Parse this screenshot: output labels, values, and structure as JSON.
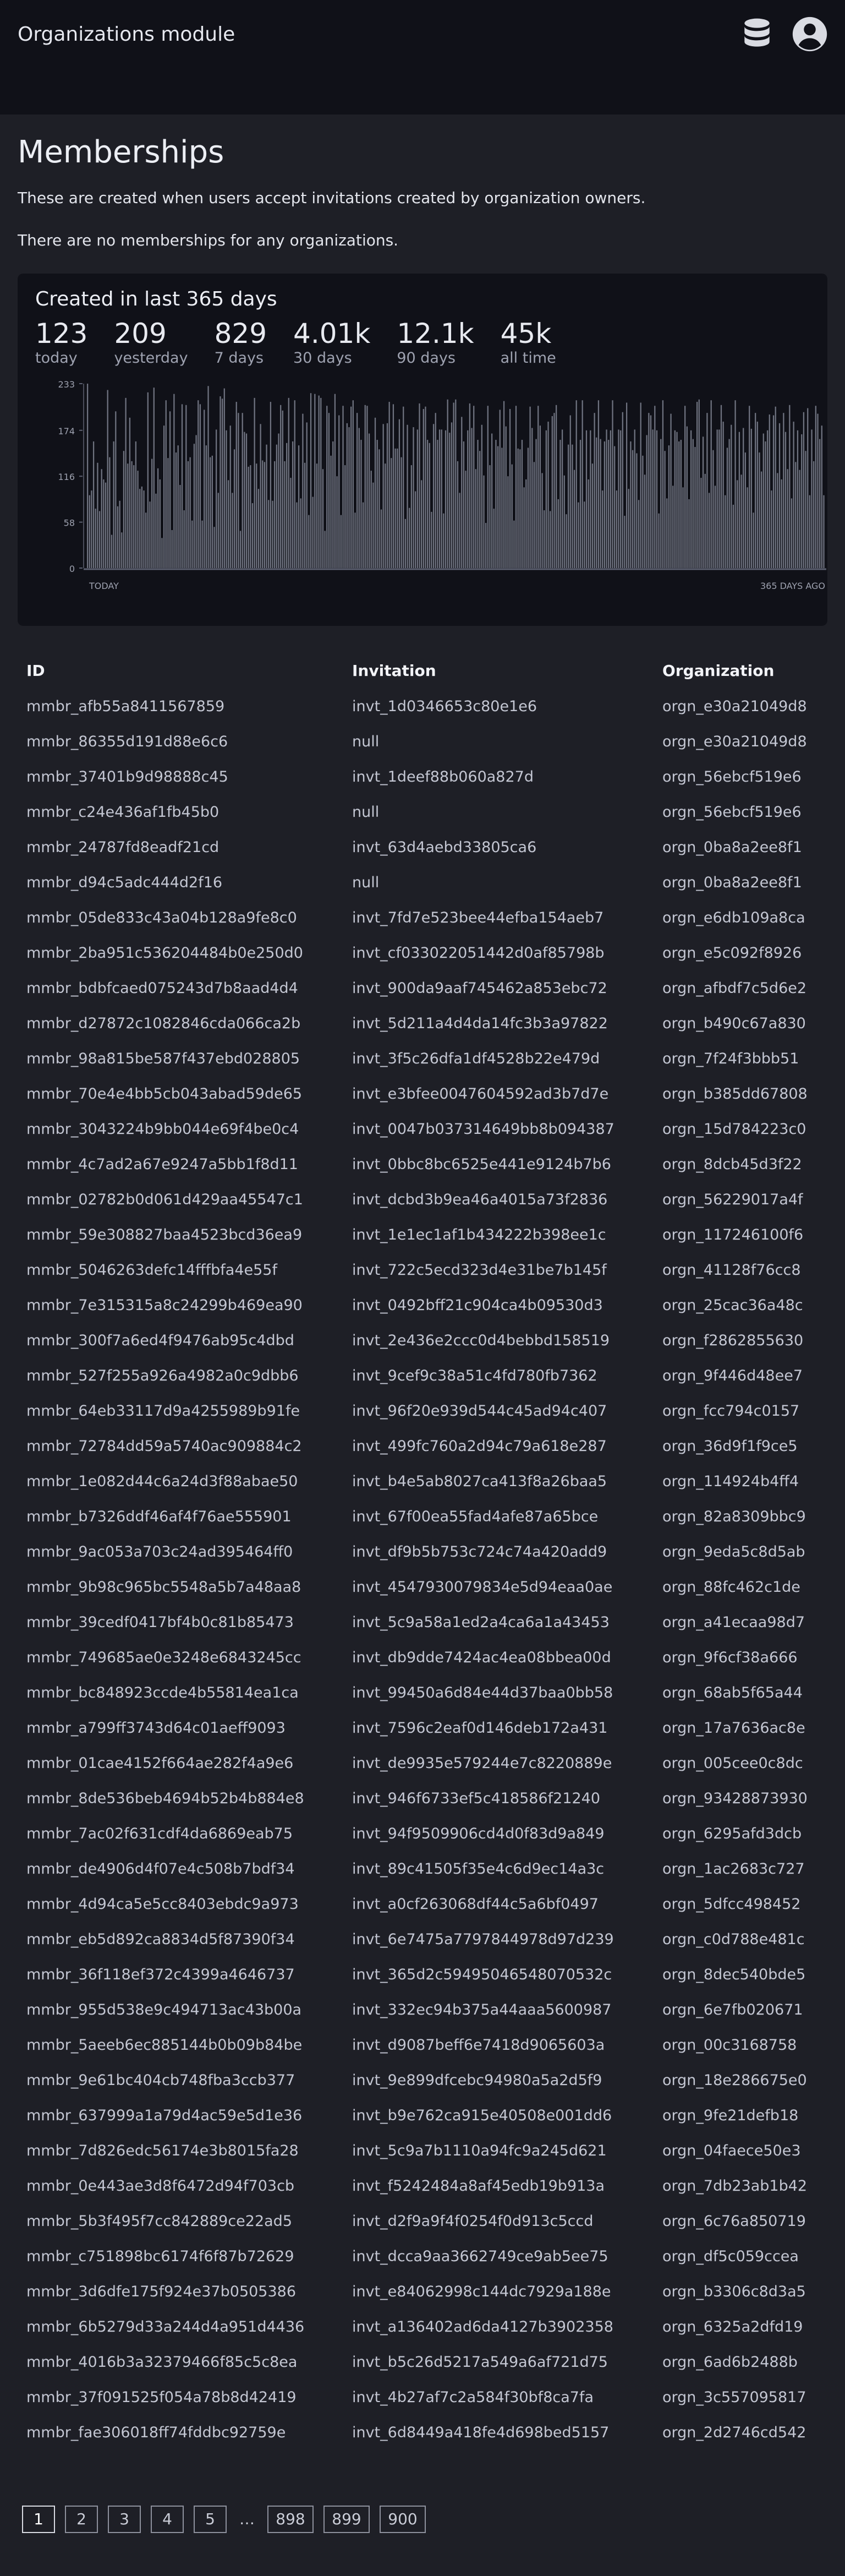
{
  "header": {
    "title": "Organizations module",
    "icons": [
      "database-icon",
      "user-account-icon"
    ]
  },
  "main": {
    "title": "Memberships",
    "description": "These are created when users accept invitations created by organization owners.",
    "empty_note": "There are no memberships for any organizations."
  },
  "stats_card": {
    "title": "Created in last 365 days",
    "stats": [
      {
        "value": "123",
        "label": "today"
      },
      {
        "value": "209",
        "label": "yesterday"
      },
      {
        "value": "829",
        "label": "7 days"
      },
      {
        "value": "4.01k",
        "label": "30 days"
      },
      {
        "value": "12.1k",
        "label": "90 days"
      },
      {
        "value": "45k",
        "label": "all time"
      }
    ]
  },
  "chart_data": {
    "type": "bar",
    "title": "",
    "xlabel": "",
    "ylabel": "",
    "x_start_label": "TODAY",
    "x_end_label": "365 DAYS AGO",
    "y_ticks": [
      0,
      58,
      116,
      174,
      233
    ],
    "ylim": [
      0,
      233
    ],
    "grid": false,
    "bar_color": "#6f7380",
    "values": [
      233,
      92,
      98,
      160,
      75,
      133,
      72,
      125,
      112,
      108,
      225,
      140,
      42,
      160,
      198,
      78,
      85,
      45,
      148,
      215,
      132,
      190,
      135,
      130,
      160,
      123,
      100,
      103,
      98,
      70,
      222,
      84,
      138,
      228,
      94,
      126,
      112,
      38,
      180,
      212,
      139,
      198,
      48,
      220,
      146,
      155,
      105,
      207,
      73,
      206,
      135,
      140,
      60,
      157,
      168,
      212,
      207,
      60,
      200,
      155,
      230,
      140,
      142,
      52,
      175,
      95,
      217,
      214,
      227,
      174,
      111,
      180,
      95,
      150,
      210,
      196,
      47,
      196,
      172,
      170,
      128,
      130,
      82,
      215,
      132,
      100,
      182,
      136,
      134,
      156,
      86,
      210,
      85,
      135,
      156,
      170,
      206,
      199,
      135,
      158,
      215,
      114,
      160,
      212,
      83,
      155,
      88,
      195,
      133,
      184,
      67,
      221,
      90,
      220,
      132,
      218,
      215,
      125,
      47,
      205,
      196,
      142,
      160,
      220,
      116,
      193,
      67,
      205,
      130,
      183,
      178,
      204,
      212,
      70,
      196,
      177,
      162,
      83,
      206,
      205,
      170,
      123,
      108,
      190,
      162,
      150,
      74,
      182,
      132,
      183,
      210,
      139,
      207,
      151,
      151,
      188,
      140,
      204,
      62,
      181,
      76,
      130,
      178,
      97,
      175,
      208,
      111,
      201,
      204,
      162,
      158,
      71,
      182,
      196,
      162,
      175,
      175,
      69,
      174,
      213,
      171,
      184,
      209,
      213,
      135,
      95,
      191,
      160,
      123,
      174,
      208,
      177,
      205,
      125,
      162,
      148,
      181,
      117,
      57,
      205,
      130,
      170,
      75,
      162,
      154,
      200,
      152,
      211,
      179,
      116,
      201,
      131,
      60,
      205,
      151,
      150,
      162,
      102,
      112,
      152,
      204,
      177,
      134,
      163,
      205,
      180,
      120,
      73,
      174,
      185,
      72,
      192,
      196,
      206,
      87,
      162,
      175,
      117,
      68,
      156,
      193,
      156,
      124,
      212,
      83,
      162,
      212,
      84,
      174,
      112,
      174,
      132,
      196,
      165,
      212,
      163,
      98,
      160,
      175,
      162,
      174,
      212,
      154,
      98,
      175,
      174,
      197,
      66,
      209,
      100,
      160,
      149,
      175,
      145,
      86,
      209,
      142,
      118,
      168,
      196,
      193,
      175,
      205,
      174,
      69,
      163,
      212,
      148,
      88,
      155,
      195,
      104,
      174,
      172,
      160,
      162,
      102,
      205,
      179,
      87,
      174,
      163,
      153,
      210,
      213,
      114,
      166,
      119,
      196,
      95,
      212,
      149,
      104,
      175,
      175,
      206,
      185,
      92,
      152,
      163,
      181,
      80,
      212,
      111,
      172,
      118,
      177,
      146,
      102,
      205,
      176,
      70,
      196,
      185,
      146,
      122,
      170,
      160,
      174,
      194,
      98,
      193,
      204,
      120,
      183,
      112,
      196,
      172,
      125,
      206,
      88,
      185,
      134,
      174,
      124,
      169,
      197,
      148,
      202,
      92,
      175,
      135,
      205,
      195,
      163,
      180,
      92
    ]
  },
  "table": {
    "headers": [
      "ID",
      "Invitation",
      "Organization"
    ],
    "rows": [
      [
        "mmbr_afb55a8411567859",
        "invt_1d0346653c80e1e6",
        "orgn_e30a21049d8"
      ],
      [
        "mmbr_86355d191d88e6c6",
        "null",
        "orgn_e30a21049d8"
      ],
      [
        "mmbr_37401b9d98888c45",
        "invt_1deef88b060a827d",
        "orgn_56ebcf519e6"
      ],
      [
        "mmbr_c24e436af1fb45b0",
        "null",
        "orgn_56ebcf519e6"
      ],
      [
        "mmbr_24787fd8eadf21cd",
        "invt_63d4aebd33805ca6",
        "orgn_0ba8a2ee8f1"
      ],
      [
        "mmbr_d94c5adc444d2f16",
        "null",
        "orgn_0ba8a2ee8f1"
      ],
      [
        "mmbr_05de833c43a04b128a9fe8c0",
        "invt_7fd7e523bee44efba154aeb7",
        "orgn_e6db109a8ca"
      ],
      [
        "mmbr_2ba951c536204484b0e250d0",
        "invt_cf033022051442d0af85798b",
        "orgn_e5c092f8926"
      ],
      [
        "mmbr_bdbfcaed075243d7b8aad4d4",
        "invt_900da9aaf745462a853ebc72",
        "orgn_afbdf7c5d6e2"
      ],
      [
        "mmbr_d27872c1082846cda066ca2b",
        "invt_5d211a4d4da14fc3b3a97822",
        "orgn_b490c67a830"
      ],
      [
        "mmbr_98a815be587f437ebd028805",
        "invt_3f5c26dfa1df4528b22e479d",
        "orgn_7f24f3bbb51"
      ],
      [
        "mmbr_70e4e4bb5cb043abad59de65",
        "invt_e3bfee0047604592ad3b7d7e",
        "orgn_b385dd67808"
      ],
      [
        "mmbr_3043224b9bb044e69f4be0c4",
        "invt_0047b037314649bb8b094387",
        "orgn_15d784223c0"
      ],
      [
        "mmbr_4c7ad2a67e9247a5bb1f8d11",
        "invt_0bbc8bc6525e441e9124b7b6",
        "orgn_8dcb45d3f22"
      ],
      [
        "mmbr_02782b0d061d429aa45547c1",
        "invt_dcbd3b9ea46a4015a73f2836",
        "orgn_56229017a4f"
      ],
      [
        "mmbr_59e308827baa4523bcd36ea9",
        "invt_1e1ec1af1b434222b398ee1c",
        "orgn_117246100f6"
      ],
      [
        "mmbr_5046263defc14fffbfa4e55f",
        "invt_722c5ecd323d4e31be7b145f",
        "orgn_41128f76cc8"
      ],
      [
        "mmbr_7e315315a8c24299b469ea90",
        "invt_0492bff21c904ca4b09530d3",
        "orgn_25cac36a48c"
      ],
      [
        "mmbr_300f7a6ed4f9476ab95c4dbd",
        "invt_2e436e2ccc0d4bebbd158519",
        "orgn_f2862855630"
      ],
      [
        "mmbr_527f255a926a4982a0c9dbb6",
        "invt_9cef9c38a51c4fd780fb7362",
        "orgn_9f446d48ee7"
      ],
      [
        "mmbr_64eb33117d9a4255989b91fe",
        "invt_96f20e939d544c45ad94c407",
        "orgn_fcc794c0157"
      ],
      [
        "mmbr_72784dd59a5740ac909884c2",
        "invt_499fc760a2d94c79a618e287",
        "orgn_36d9f1f9ce5"
      ],
      [
        "mmbr_1e082d44c6a24d3f88abae50",
        "invt_b4e5ab8027ca413f8a26baa5",
        "orgn_114924b4ff4"
      ],
      [
        "mmbr_b7326ddf46af4f76ae555901",
        "invt_67f00ea55fad4afe87a65bce",
        "orgn_82a8309bbc9"
      ],
      [
        "mmbr_9ac053a703c24ad395464ff0",
        "invt_df9b5b753c724c74a420add9",
        "orgn_9eda5c8d5ab"
      ],
      [
        "mmbr_9b98c965bc5548a5b7a48aa8",
        "invt_4547930079834e5d94eaa0ae",
        "orgn_88fc462c1de"
      ],
      [
        "mmbr_39cedf0417bf4b0c81b85473",
        "invt_5c9a58a1ed2a4ca6a1a43453",
        "orgn_a41ecaa98d7"
      ],
      [
        "mmbr_749685ae0e3248e6843245cc",
        "invt_db9dde7424ac4ea08bbea00d",
        "orgn_9f6cf38a666"
      ],
      [
        "mmbr_bc848923ccde4b55814ea1ca",
        "invt_99450a6d84e44d37baa0bb58",
        "orgn_68ab5f65a44"
      ],
      [
        "mmbr_a799ff3743d64c01aeff9093",
        "invt_7596c2eaf0d146deb172a431",
        "orgn_17a7636ac8e"
      ],
      [
        "mmbr_01cae4152f664ae282f4a9e6",
        "invt_de9935e579244e7c8220889e",
        "orgn_005cee0c8dc"
      ],
      [
        "mmbr_8de536beb4694b52b4b884e8",
        "invt_946f6733ef5c418586f21240",
        "orgn_93428873930"
      ],
      [
        "mmbr_7ac02f631cdf4da6869eab75",
        "invt_94f9509906cd4d0f83d9a849",
        "orgn_6295afd3dcb"
      ],
      [
        "mmbr_de4906d4f07e4c508b7bdf34",
        "invt_89c41505f35e4c6d9ec14a3c",
        "orgn_1ac2683c727"
      ],
      [
        "mmbr_4d94ca5e5cc8403ebdc9a973",
        "invt_a0cf263068df44c5a6bf0497",
        "orgn_5dfcc498452"
      ],
      [
        "mmbr_eb5d892ca8834d5f87390f34",
        "invt_6e7475a7797844978d97d239",
        "orgn_c0d788e481c"
      ],
      [
        "mmbr_36f118ef372c4399a4646737",
        "invt_365d2c59495046548070532c",
        "orgn_8dec540bde5"
      ],
      [
        "mmbr_955d538e9c494713ac43b00a",
        "invt_332ec94b375a44aaa5600987",
        "orgn_6e7fb020671"
      ],
      [
        "mmbr_5aeeb6ec885144b0b09b84be",
        "invt_d9087beff6e7418d9065603a",
        "orgn_00c3168758"
      ],
      [
        "mmbr_9e61bc404cb748fba3ccb377",
        "invt_9e899dfcebc94980a5a2d5f9",
        "orgn_18e286675e0"
      ],
      [
        "mmbr_637999a1a79d4ac59e5d1e36",
        "invt_b9e762ca915e40508e001dd6",
        "orgn_9fe21defb18"
      ],
      [
        "mmbr_7d826edc56174e3b8015fa28",
        "invt_5c9a7b1110a94fc9a245d621",
        "orgn_04faece50e3"
      ],
      [
        "mmbr_0e443ae3d8f6472d94f703cb",
        "invt_f5242484a8af45edb19b913a",
        "orgn_7db23ab1b42"
      ],
      [
        "mmbr_5b3f495f7cc842889ce22ad5",
        "invt_d2f9a9f4f0254f0d913c5ccd",
        "orgn_6c76a850719"
      ],
      [
        "mmbr_c751898bc6174f6f87b72629",
        "invt_dcca9aa3662749ce9ab5ee75",
        "orgn_df5c059ccea"
      ],
      [
        "mmbr_3d6dfe175f924e37b0505386",
        "invt_e84062998c144dc7929a188e",
        "orgn_b3306c8d3a5"
      ],
      [
        "mmbr_6b5279d33a244d4a951d4436",
        "invt_a136402ad6da4127b3902358",
        "orgn_6325a2dfd19"
      ],
      [
        "mmbr_4016b3a32379466f85c5c8ea",
        "invt_b5c26d5217a549a6af721d75",
        "orgn_6ad6b2488b"
      ],
      [
        "mmbr_37f091525f054a78b8d42419",
        "invt_4b27af7c2a584f30bf8ca7fa",
        "orgn_3c557095817"
      ],
      [
        "mmbr_fae306018ff74fddbc92759e",
        "invt_6d8449a418fe4d698bed5157",
        "orgn_2d2746cd542"
      ]
    ]
  },
  "pagination": {
    "pages": [
      "1",
      "2",
      "3",
      "4",
      "5",
      "…",
      "898",
      "899",
      "900"
    ],
    "active": "1"
  },
  "colors": {
    "header_bg": "#101118",
    "page_bg": "#1e1f26",
    "card_bg": "#101118",
    "bar": "#6f7380"
  }
}
